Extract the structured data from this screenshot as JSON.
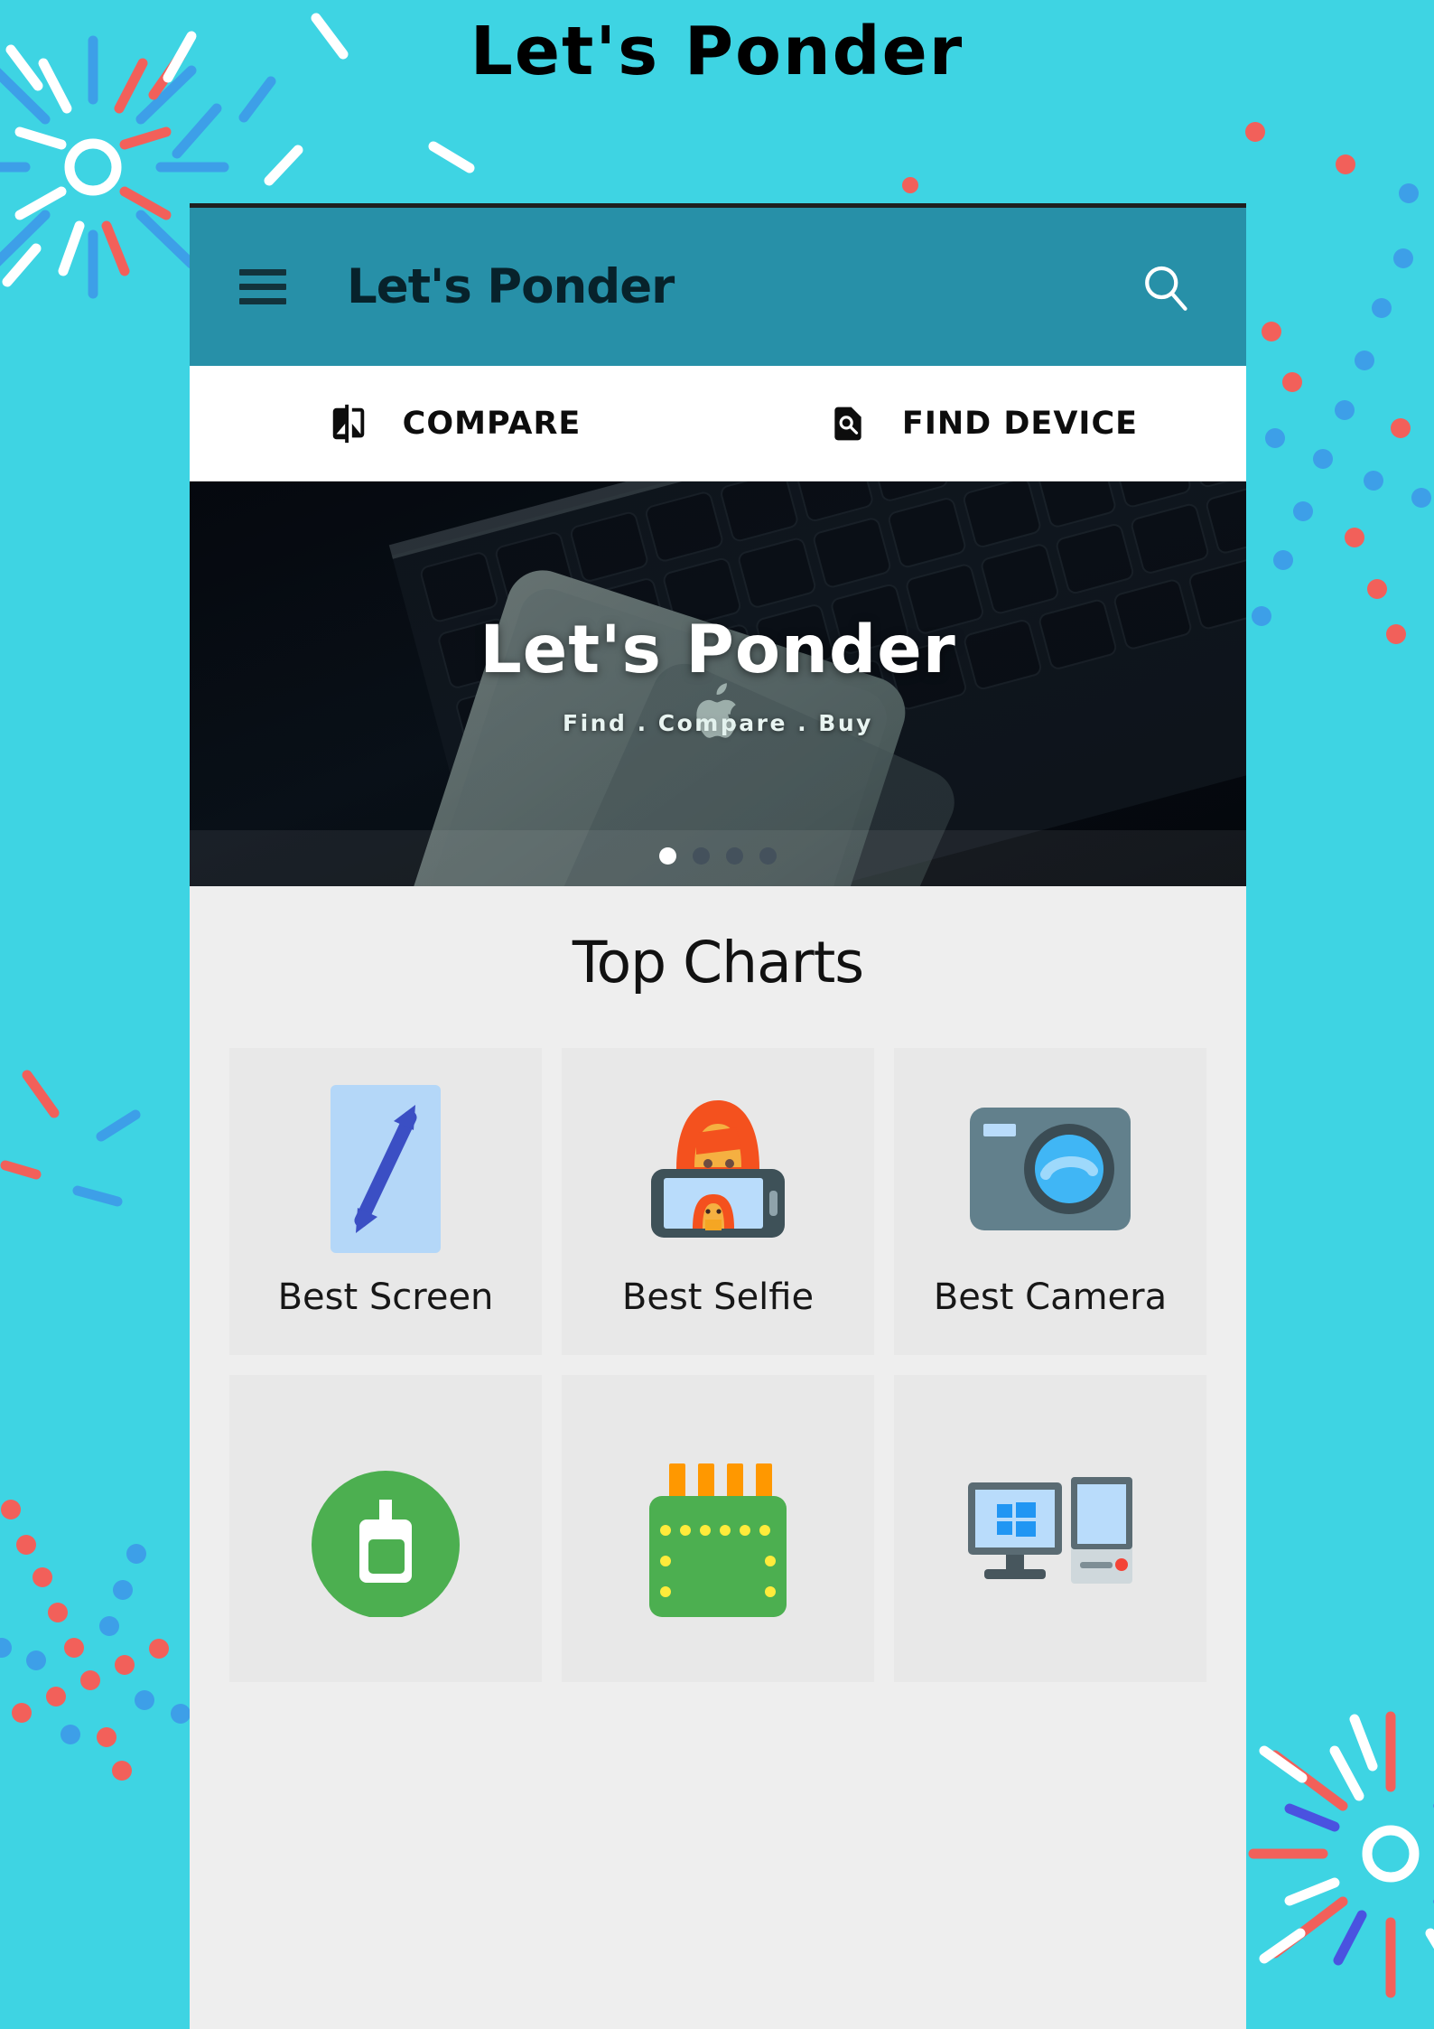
{
  "page": {
    "title": "Let's Ponder",
    "background_color": "#3ed4e3",
    "confetti_colors": {
      "blue": "#3d9fe8",
      "red": "#f2605a",
      "white": "#ffffff",
      "indigo": "#4a52e0"
    }
  },
  "appbar": {
    "title": "Let's Ponder",
    "background_color": "#2790a8",
    "menu_icon": "hamburger-menu-icon",
    "search_icon": "search-icon"
  },
  "tabs": [
    {
      "label": "COMPARE",
      "icon": "compare-icon"
    },
    {
      "label": "FIND DEVICE",
      "icon": "find-in-page-icon"
    }
  ],
  "hero": {
    "title": "Let's Ponder",
    "subtitle": "Find . Compare . Buy",
    "logo_icon": "apple-logo-icon",
    "dots_total": 4,
    "dot_active_index": 0
  },
  "main": {
    "section_title": "Top Charts",
    "cards_row1": [
      {
        "label": "Best Screen",
        "icon": "screen-size-arrow-icon"
      },
      {
        "label": "Best Selfie",
        "icon": "selfie-person-phone-icon"
      },
      {
        "label": "Best Camera",
        "icon": "camera-icon"
      }
    ],
    "cards_row2": [
      {
        "label": "",
        "icon": "battery-charging-circle-icon"
      },
      {
        "label": "",
        "icon": "processor-chip-icon"
      },
      {
        "label": "",
        "icon": "desktop-computer-icon"
      }
    ]
  }
}
